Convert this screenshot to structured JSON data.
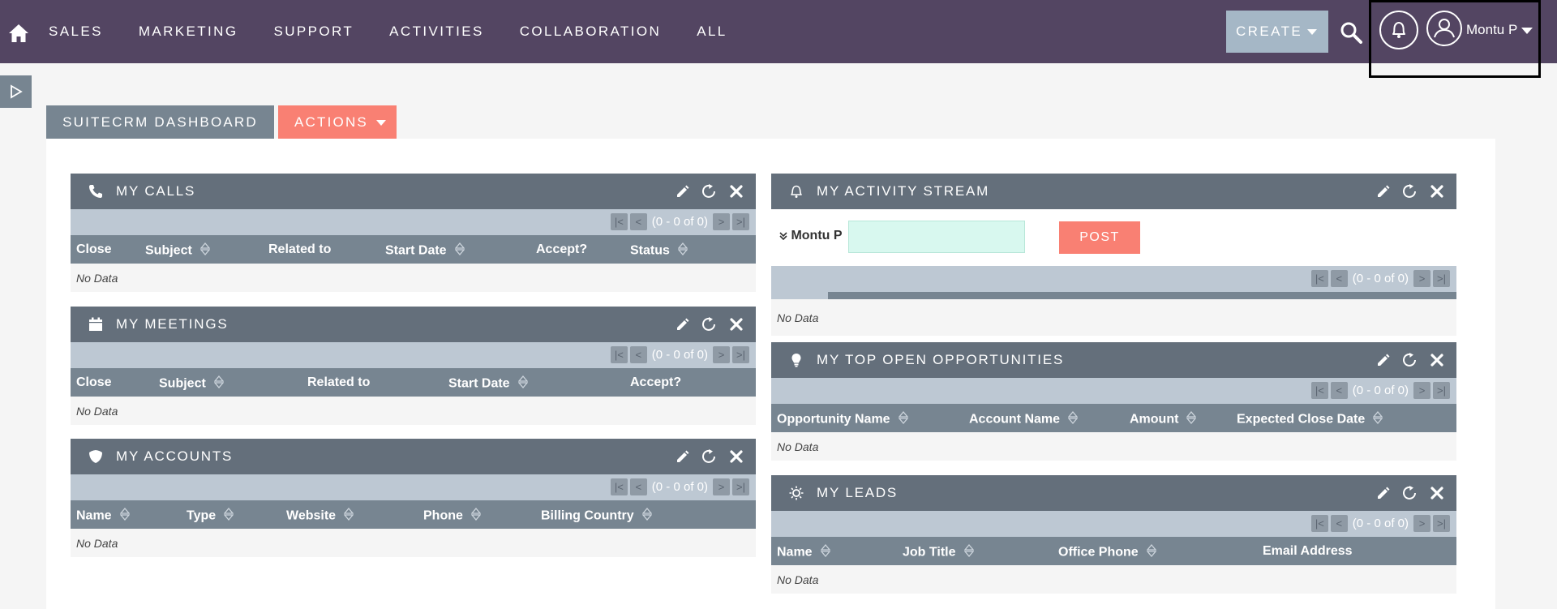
{
  "nav": {
    "items": [
      "SALES",
      "MARKETING",
      "SUPPORT",
      "ACTIVITIES",
      "COLLABORATION",
      "ALL"
    ],
    "create_label": "CREATE",
    "user_name": "Montu P"
  },
  "tabs": {
    "dashboard": "SUITECRM DASHBOARD",
    "actions": "ACTIONS"
  },
  "pager_text": "(0 - 0 of 0)",
  "no_data": "No Data",
  "dashlets": {
    "calls": {
      "title": "MY CALLS",
      "columns": [
        "Close",
        "Subject",
        "Related to",
        "Start Date",
        "Accept?",
        "Status"
      ]
    },
    "meetings": {
      "title": "MY MEETINGS",
      "columns": [
        "Close",
        "Subject",
        "Related to",
        "Start Date",
        "Accept?"
      ]
    },
    "accounts": {
      "title": "MY ACCOUNTS",
      "columns": [
        "Name",
        "Type",
        "Website",
        "Phone",
        "Billing Country"
      ]
    },
    "activity": {
      "title": "MY ACTIVITY STREAM",
      "user_label": "Montu P",
      "post_label": "POST"
    },
    "opportunities": {
      "title": "MY TOP OPEN OPPORTUNITIES",
      "columns": [
        "Opportunity Name",
        "Account Name",
        "Amount",
        "Expected Close Date"
      ]
    },
    "leads": {
      "title": "MY LEADS",
      "columns": [
        "Name",
        "Job Title",
        "Office Phone",
        "Email Address"
      ]
    }
  }
}
